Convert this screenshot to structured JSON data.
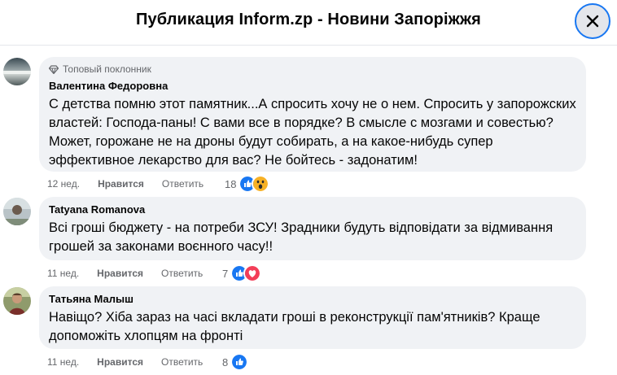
{
  "header": {
    "title": "Публикация Inform.zp - Новини Запоріжжя",
    "close_icon": "close-icon"
  },
  "colors": {
    "accent": "#1877f2",
    "bubble": "#f0f2f5",
    "secondary_text": "#65676b",
    "love": "#f33e58",
    "wow": "#f7b125"
  },
  "comments": [
    {
      "badge": "Топовый поклонник",
      "author": "Валентина Федоровна",
      "text": "С детства помню этот памятник...А спросить хочу не о нем. Спросить у запорожских властей: Господа-паны! С вами все в порядке? В смысле с мозгами и совестью? Может, горожане не на дроны будут собирать, а на какое-нибудь супер эффективное лекарство для вас? Не бойтесь - задонатим!",
      "time": "12 нед.",
      "like": "Нравится",
      "reply": "Ответить",
      "reaction_count": "18",
      "reactions": [
        "like-icon",
        "wow-icon"
      ]
    },
    {
      "author": "Tatyana Romanova",
      "text": "Всі гроші бюджету - на потреби ЗСУ! Зрадники будуть відповідати за відмивання грошей за законами воєнного часу!!",
      "time": "11 нед.",
      "like": "Нравится",
      "reply": "Ответить",
      "reaction_count": "7",
      "reactions": [
        "like-icon",
        "love-icon"
      ]
    },
    {
      "author": "Татьяна Малыш",
      "text": "Навіщо? Хіба зараз на часі вкладати гроші в реконструкції пам'ятників? Краще допоможіть хлопцям на фронті",
      "time": "11 нед.",
      "like": "Нравится",
      "reply": "Ответить",
      "reaction_count": "8",
      "reactions": [
        "like-icon"
      ]
    }
  ]
}
